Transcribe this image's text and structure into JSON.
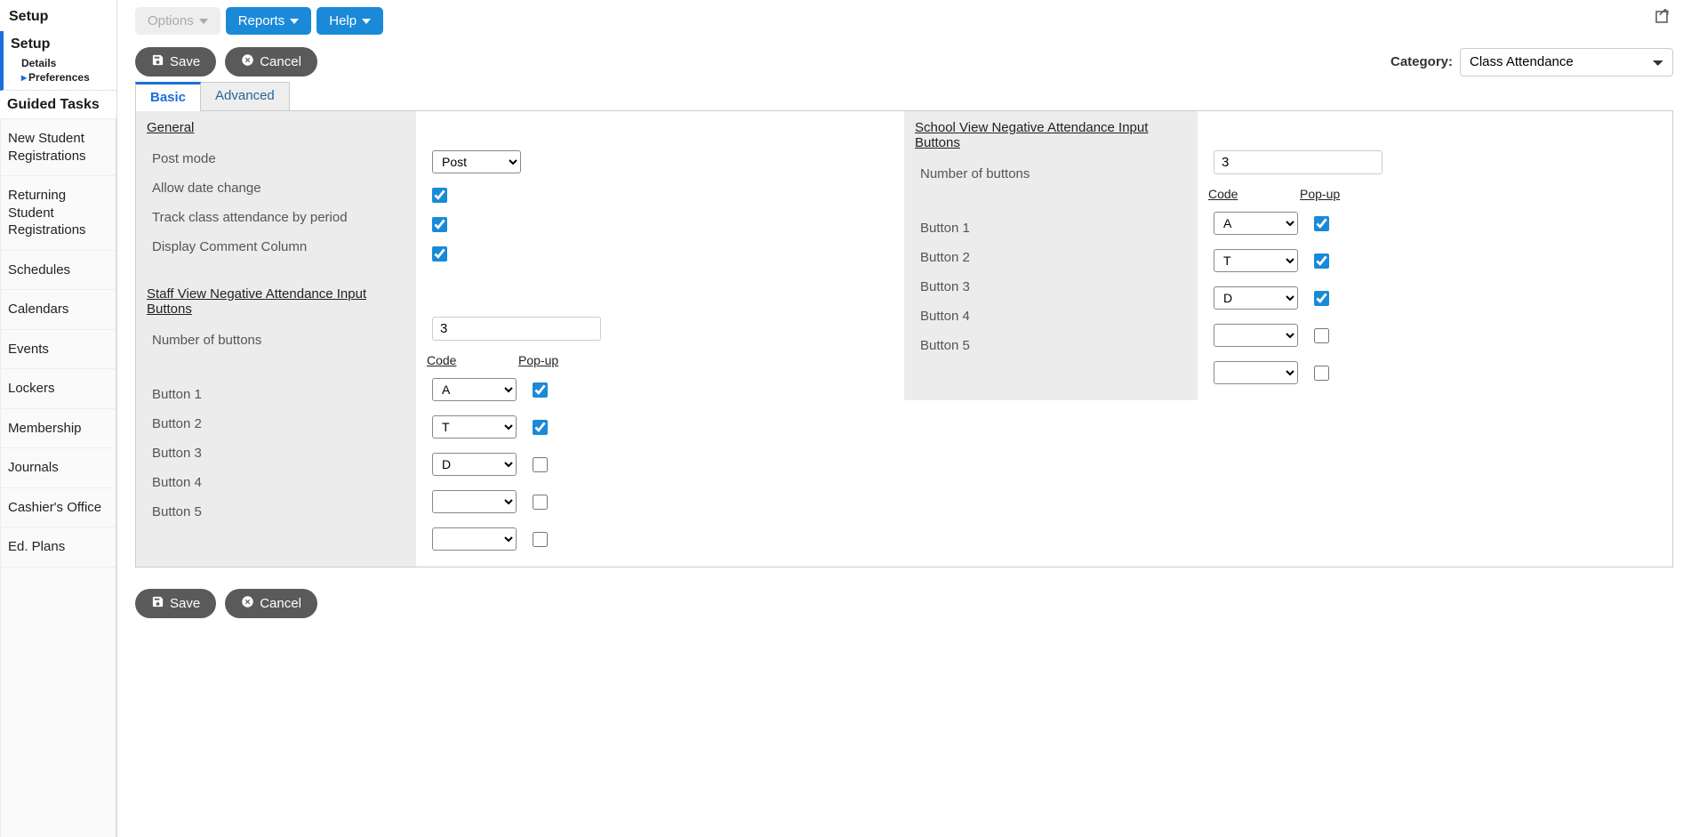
{
  "page_title": "Setup",
  "sidebar": {
    "setup": {
      "title": "Setup",
      "items": [
        {
          "label": "Details",
          "active": false
        },
        {
          "label": "Preferences",
          "active": true
        }
      ]
    },
    "guided_title": "Guided Tasks",
    "items": [
      "New Student Registrations",
      "Returning Student Registrations",
      "Schedules",
      "Calendars",
      "Events",
      "Lockers",
      "Membership",
      "Journals",
      "Cashier's Office",
      "Ed. Plans"
    ]
  },
  "topbar": {
    "options": "Options",
    "reports": "Reports",
    "help": "Help"
  },
  "actions": {
    "save": "Save",
    "cancel": "Cancel"
  },
  "category": {
    "label": "Category:",
    "value": "Class Attendance"
  },
  "tabs": {
    "basic": "Basic",
    "advanced": "Advanced"
  },
  "form": {
    "general": {
      "heading": "General",
      "post_mode_label": "Post mode",
      "post_mode_value": "Post",
      "allow_date_change_label": "Allow date change",
      "allow_date_change": true,
      "track_period_label": "Track class attendance by period",
      "track_period": true,
      "display_comment_label": "Display Comment Column",
      "display_comment": true
    },
    "staff_buttons": {
      "heading": "Staff View Negative Attendance Input Buttons",
      "number_label": "Number of buttons",
      "number_value": "3",
      "code_header": "Code",
      "popup_header": "Pop-up",
      "rows": [
        {
          "label": "Button 1",
          "code": "A",
          "popup": true
        },
        {
          "label": "Button 2",
          "code": "T",
          "popup": true
        },
        {
          "label": "Button 3",
          "code": "D",
          "popup": false
        },
        {
          "label": "Button 4",
          "code": "",
          "popup": false
        },
        {
          "label": "Button 5",
          "code": "",
          "popup": false
        }
      ]
    },
    "school_buttons": {
      "heading": "School View Negative Attendance Input Buttons",
      "number_label": "Number of buttons",
      "number_value": "3",
      "code_header": "Code",
      "popup_header": "Pop-up",
      "rows": [
        {
          "label": "Button 1",
          "code": "A",
          "popup": true
        },
        {
          "label": "Button 2",
          "code": "T",
          "popup": true
        },
        {
          "label": "Button 3",
          "code": "D",
          "popup": true
        },
        {
          "label": "Button 4",
          "code": "",
          "popup": false
        },
        {
          "label": "Button 5",
          "code": "",
          "popup": false
        }
      ]
    }
  }
}
